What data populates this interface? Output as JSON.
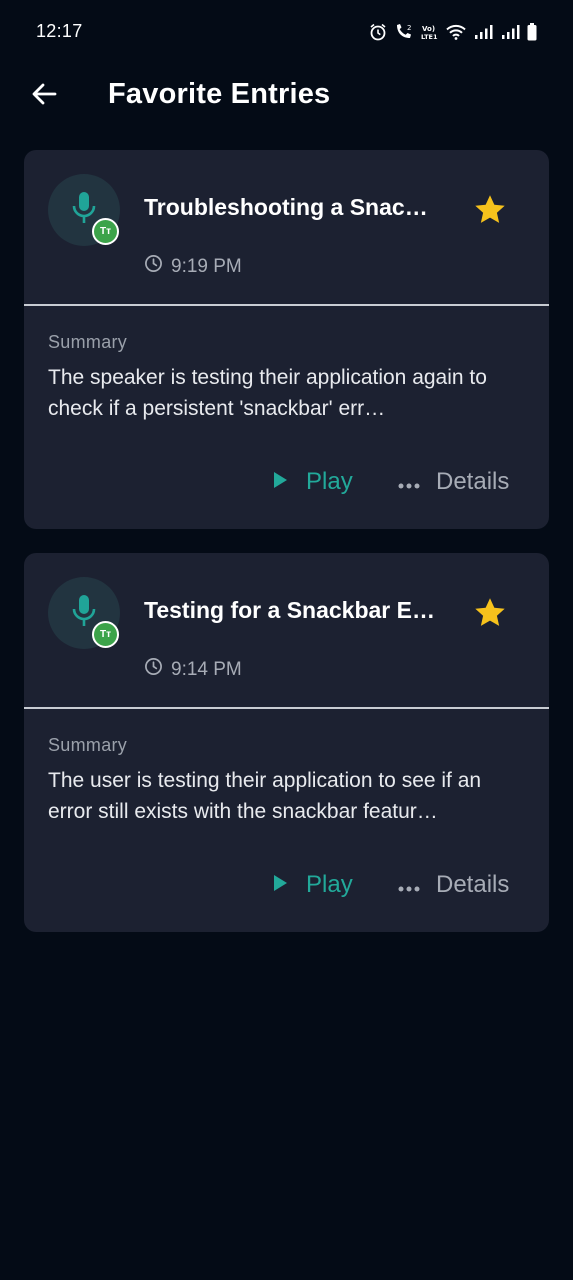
{
  "status_bar": {
    "time": "12:17",
    "volte_label": "Vo)) LTE1"
  },
  "header": {
    "title": "Favorite Entries"
  },
  "entries": [
    {
      "title": "Troubleshooting a Snac…",
      "time": "9:19 PM",
      "summary_label": "Summary",
      "summary": "The speaker is testing their application again to check if a persistent 'snackbar' err…",
      "play_label": "Play",
      "details_label": "Details",
      "badge_text": "Tт"
    },
    {
      "title": "Testing for a Snackbar E…",
      "time": "9:14 PM",
      "summary_label": "Summary",
      "summary": "The user is testing their application to see if an error still exists with the snackbar featur…",
      "play_label": "Play",
      "details_label": "Details",
      "badge_text": "Tт"
    }
  ],
  "colors": {
    "background": "#040b16",
    "card": "#1c2131",
    "accent": "#22a99a",
    "star": "#f6c21c",
    "badge": "#3ca34a"
  }
}
